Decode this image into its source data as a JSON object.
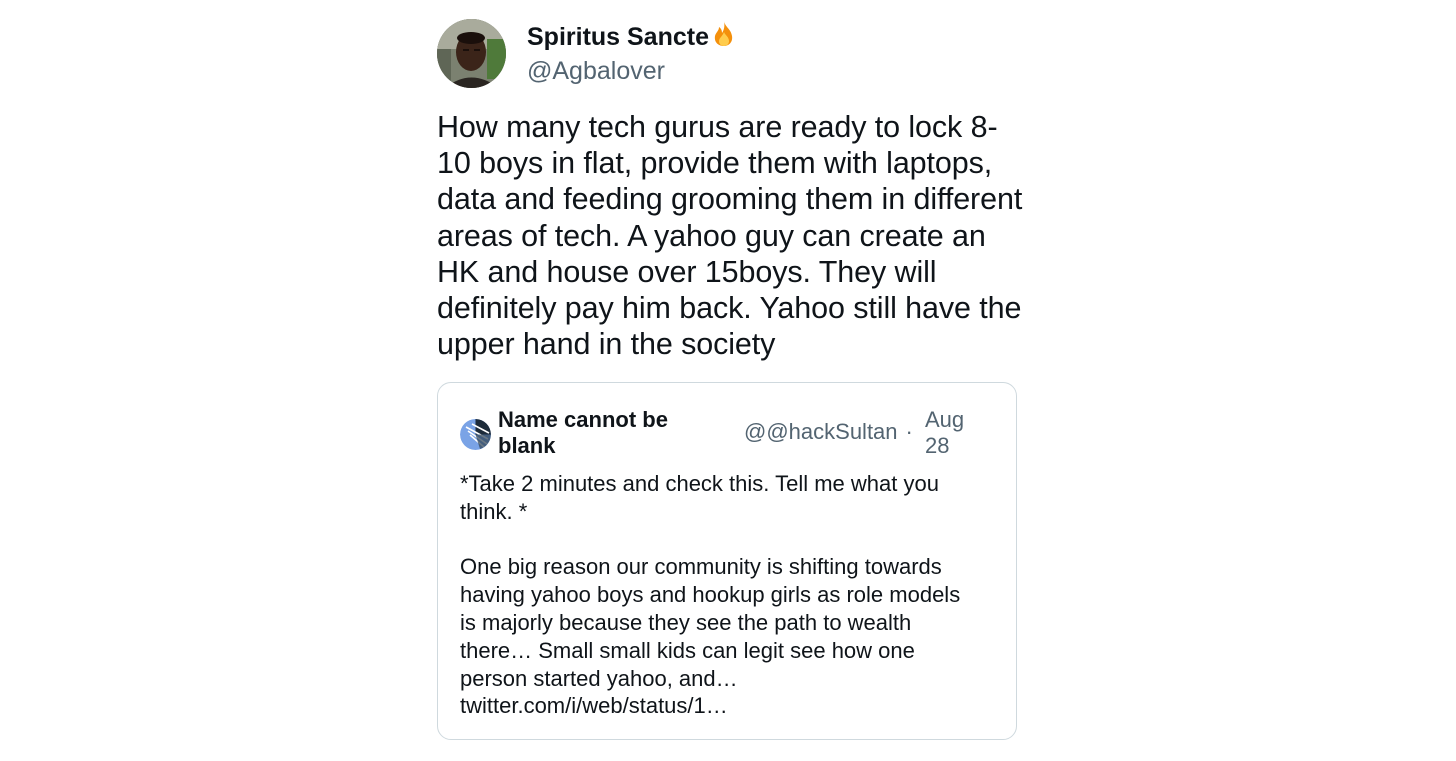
{
  "tweet": {
    "author": {
      "display_name": "Spiritus Sancte",
      "handle": "@Agbalover",
      "avatar_icon": "profile-photo",
      "emoji_icon": "fire-icon"
    },
    "text": "How many tech gurus are ready to lock 8-\n10 boys in flat, provide them with laptops,\ndata and feeding grooming them in different\nareas of tech. A yahoo guy can create an\nHK and house over 15boys. They will\ndefinitely pay him back. Yahoo still have the\nupper hand in the society"
  },
  "quote": {
    "author": {
      "display_name": "Name cannot be blank",
      "at_symbol": "@",
      "handle": "@hackSultan",
      "separator": "·",
      "date": "Aug 28",
      "avatar_icon": "abstract-avatar"
    },
    "text": "*Take 2 minutes and check this. Tell me what you\nthink. *\n\nOne big reason our community is shifting towards\nhaving yahoo boys and hookup girls as role models\nis majorly because they see the path to wealth\nthere… Small small kids can legit see how one\nperson started yahoo, and…\ntwitter.com/i/web/status/1…"
  },
  "colors": {
    "text": "#0f1419",
    "secondary": "#536471",
    "border": "#cfd9de"
  }
}
